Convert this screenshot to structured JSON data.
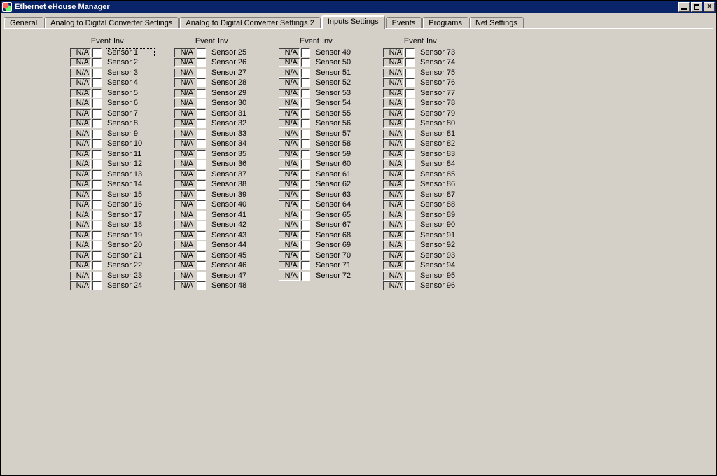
{
  "window": {
    "title": "Ethernet eHouse Manager"
  },
  "tabs": [
    {
      "label": "General"
    },
    {
      "label": "Analog to Digital Converter Settings"
    },
    {
      "label": "Analog to Digital Converter Settings 2"
    },
    {
      "label": "Inputs Settings"
    },
    {
      "label": "Events"
    },
    {
      "label": "Programs"
    },
    {
      "label": "Net Settings"
    }
  ],
  "active_tab": 3,
  "headers": {
    "event": "Event",
    "inv": "Inv"
  },
  "default_event": "N/A",
  "column_skip": {
    "66": true
  },
  "columns": [
    [
      {
        "n": 1,
        "name": "Sensor 1",
        "sel": true
      },
      {
        "n": 2,
        "name": "Sensor 2"
      },
      {
        "n": 3,
        "name": "Sensor 3"
      },
      {
        "n": 4,
        "name": "Sensor 4"
      },
      {
        "n": 5,
        "name": "Sensor 5"
      },
      {
        "n": 6,
        "name": "Sensor 6"
      },
      {
        "n": 7,
        "name": "Sensor 7"
      },
      {
        "n": 8,
        "name": "Sensor 8"
      },
      {
        "n": 9,
        "name": "Sensor 9"
      },
      {
        "n": 10,
        "name": "Sensor 10"
      },
      {
        "n": 11,
        "name": "Sensor 11"
      },
      {
        "n": 12,
        "name": "Sensor 12"
      },
      {
        "n": 13,
        "name": "Sensor 13"
      },
      {
        "n": 14,
        "name": "Sensor 14"
      },
      {
        "n": 15,
        "name": "Sensor 15"
      },
      {
        "n": 16,
        "name": "Sensor 16"
      },
      {
        "n": 17,
        "name": "Sensor 17"
      },
      {
        "n": 18,
        "name": "Sensor 18"
      },
      {
        "n": 19,
        "name": "Sensor 19"
      },
      {
        "n": 20,
        "name": "Sensor 20"
      },
      {
        "n": 21,
        "name": "Sensor 21"
      },
      {
        "n": 22,
        "name": "Sensor 22"
      },
      {
        "n": 23,
        "name": "Sensor 23"
      },
      {
        "n": 24,
        "name": "Sensor 24"
      }
    ],
    [
      {
        "n": 25,
        "name": "Sensor 25"
      },
      {
        "n": 26,
        "name": "Sensor 26"
      },
      {
        "n": 27,
        "name": "Sensor 27"
      },
      {
        "n": 28,
        "name": "Sensor 28"
      },
      {
        "n": 29,
        "name": "Sensor 29"
      },
      {
        "n": 30,
        "name": "Sensor 30"
      },
      {
        "n": 31,
        "name": "Sensor 31"
      },
      {
        "n": 32,
        "name": "Sensor 32"
      },
      {
        "n": 33,
        "name": "Sensor 33"
      },
      {
        "n": 34,
        "name": "Sensor 34"
      },
      {
        "n": 35,
        "name": "Sensor 35"
      },
      {
        "n": 36,
        "name": "Sensor 36"
      },
      {
        "n": 37,
        "name": "Sensor 37"
      },
      {
        "n": 38,
        "name": "Sensor 38"
      },
      {
        "n": 39,
        "name": "Sensor 39"
      },
      {
        "n": 40,
        "name": "Sensor 40"
      },
      {
        "n": 41,
        "name": "Sensor 41"
      },
      {
        "n": 42,
        "name": "Sensor 42"
      },
      {
        "n": 43,
        "name": "Sensor 43"
      },
      {
        "n": 44,
        "name": "Sensor 44"
      },
      {
        "n": 45,
        "name": "Sensor 45"
      },
      {
        "n": 46,
        "name": "Sensor 46"
      },
      {
        "n": 47,
        "name": "Sensor 47"
      },
      {
        "n": 48,
        "name": "Sensor 48"
      }
    ],
    [
      {
        "n": 49,
        "name": "Sensor 49"
      },
      {
        "n": 50,
        "name": "Sensor 50"
      },
      {
        "n": 51,
        "name": "Sensor 51"
      },
      {
        "n": 52,
        "name": "Sensor 52"
      },
      {
        "n": 53,
        "name": "Sensor 53"
      },
      {
        "n": 54,
        "name": "Sensor 54"
      },
      {
        "n": 55,
        "name": "Sensor 55"
      },
      {
        "n": 56,
        "name": "Sensor 56"
      },
      {
        "n": 57,
        "name": "Sensor 57"
      },
      {
        "n": 58,
        "name": "Sensor 58"
      },
      {
        "n": 59,
        "name": "Sensor 59"
      },
      {
        "n": 60,
        "name": "Sensor 60"
      },
      {
        "n": 61,
        "name": "Sensor 61"
      },
      {
        "n": 62,
        "name": "Sensor 62"
      },
      {
        "n": 63,
        "name": "Sensor 63"
      },
      {
        "n": 64,
        "name": "Sensor 64"
      },
      {
        "n": 65,
        "name": "Sensor 65"
      },
      {
        "n": 67,
        "name": "Sensor 67"
      },
      {
        "n": 68,
        "name": "Sensor 68"
      },
      {
        "n": 69,
        "name": "Sensor 69"
      },
      {
        "n": 70,
        "name": "Sensor 70"
      },
      {
        "n": 71,
        "name": "Sensor 71"
      },
      {
        "n": 72,
        "name": "Sensor 72"
      }
    ],
    [
      {
        "n": 73,
        "name": "Sensor 73"
      },
      {
        "n": 74,
        "name": "Sensor 74"
      },
      {
        "n": 75,
        "name": "Sensor 75"
      },
      {
        "n": 76,
        "name": "Sensor 76"
      },
      {
        "n": 77,
        "name": "Sensor 77"
      },
      {
        "n": 78,
        "name": "Sensor 78"
      },
      {
        "n": 79,
        "name": "Sensor 79"
      },
      {
        "n": 80,
        "name": "Sensor 80"
      },
      {
        "n": 81,
        "name": "Sensor 81"
      },
      {
        "n": 82,
        "name": "Sensor 82"
      },
      {
        "n": 83,
        "name": "Sensor 83"
      },
      {
        "n": 84,
        "name": "Sensor 84"
      },
      {
        "n": 85,
        "name": "Sensor 85"
      },
      {
        "n": 86,
        "name": "Sensor 86"
      },
      {
        "n": 87,
        "name": "Sensor 87"
      },
      {
        "n": 88,
        "name": "Sensor 88"
      },
      {
        "n": 89,
        "name": "Sensor 89"
      },
      {
        "n": 90,
        "name": "Sensor 90"
      },
      {
        "n": 91,
        "name": "Sensor 91"
      },
      {
        "n": 92,
        "name": "Sensor 92"
      },
      {
        "n": 93,
        "name": "Sensor 93"
      },
      {
        "n": 94,
        "name": "Sensor 94"
      },
      {
        "n": 95,
        "name": "Sensor 95"
      },
      {
        "n": 96,
        "name": "Sensor 96"
      }
    ]
  ]
}
